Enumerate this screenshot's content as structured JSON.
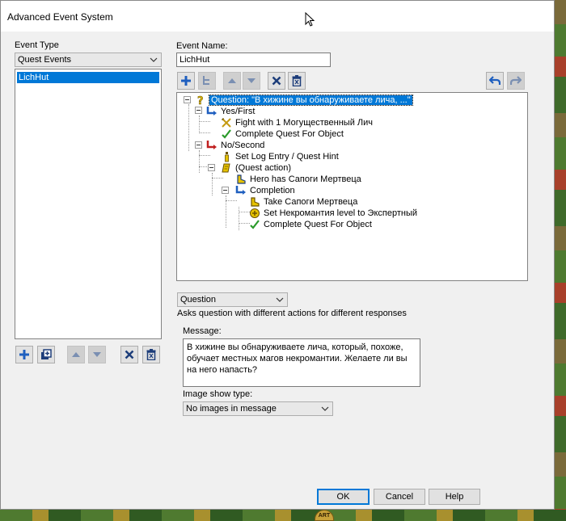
{
  "window": {
    "title": "Advanced Event System"
  },
  "left_panel": {
    "event_type_label": "Event Type",
    "event_type_value": "Quest Events",
    "events": [
      "LichHut"
    ]
  },
  "right_panel": {
    "event_name_label": "Event Name:",
    "event_name_value": "LichHut"
  },
  "tree": {
    "nodes": [
      {
        "text": "Question: \"В хижине вы обнаруживаете лича, ...\"",
        "icon": "question-mark-icon"
      },
      {
        "text": "Yes/First",
        "icon": "branch-arrow-blue-icon"
      },
      {
        "text": "Fight with 1 Могущественный Лич",
        "icon": "crossed-swords-icon"
      },
      {
        "text": "Complete Quest For Object",
        "icon": "green-check-icon"
      },
      {
        "text": "No/Second",
        "icon": "branch-arrow-red-icon"
      },
      {
        "text": "Set Log Entry / Quest Hint",
        "icon": "info-icon"
      },
      {
        "text": "(Quest action)",
        "icon": "scroll-icon"
      },
      {
        "text": "Hero has Сапоги Мертвеца",
        "icon": "boots-icon"
      },
      {
        "text": "Completion",
        "icon": "branch-arrow-blue-icon"
      },
      {
        "text": "Take Сапоги Мертвеца",
        "icon": "boots-icon"
      },
      {
        "text": "Set Некромантия level to Экспертный",
        "icon": "skill-icon"
      },
      {
        "text": "Complete Quest For Object",
        "icon": "green-check-icon"
      }
    ]
  },
  "action_type": {
    "value": "Question",
    "description": "Asks question with different actions for different responses"
  },
  "message": {
    "label": "Message:",
    "text": "В хижине вы обнаруживаете лича, который, похоже, обучает местных магов некромантии. Желаете ли вы на него напасть?"
  },
  "image_show": {
    "label": "Image show type:",
    "value": "No images in message"
  },
  "buttons": {
    "ok": "OK",
    "cancel": "Cancel",
    "help": "Help"
  },
  "background": {
    "badge": "ART"
  },
  "colors": {
    "selection": "#0078d7",
    "toolbar_blue": "#1f5fbf",
    "delete": "#1d3d7a"
  }
}
